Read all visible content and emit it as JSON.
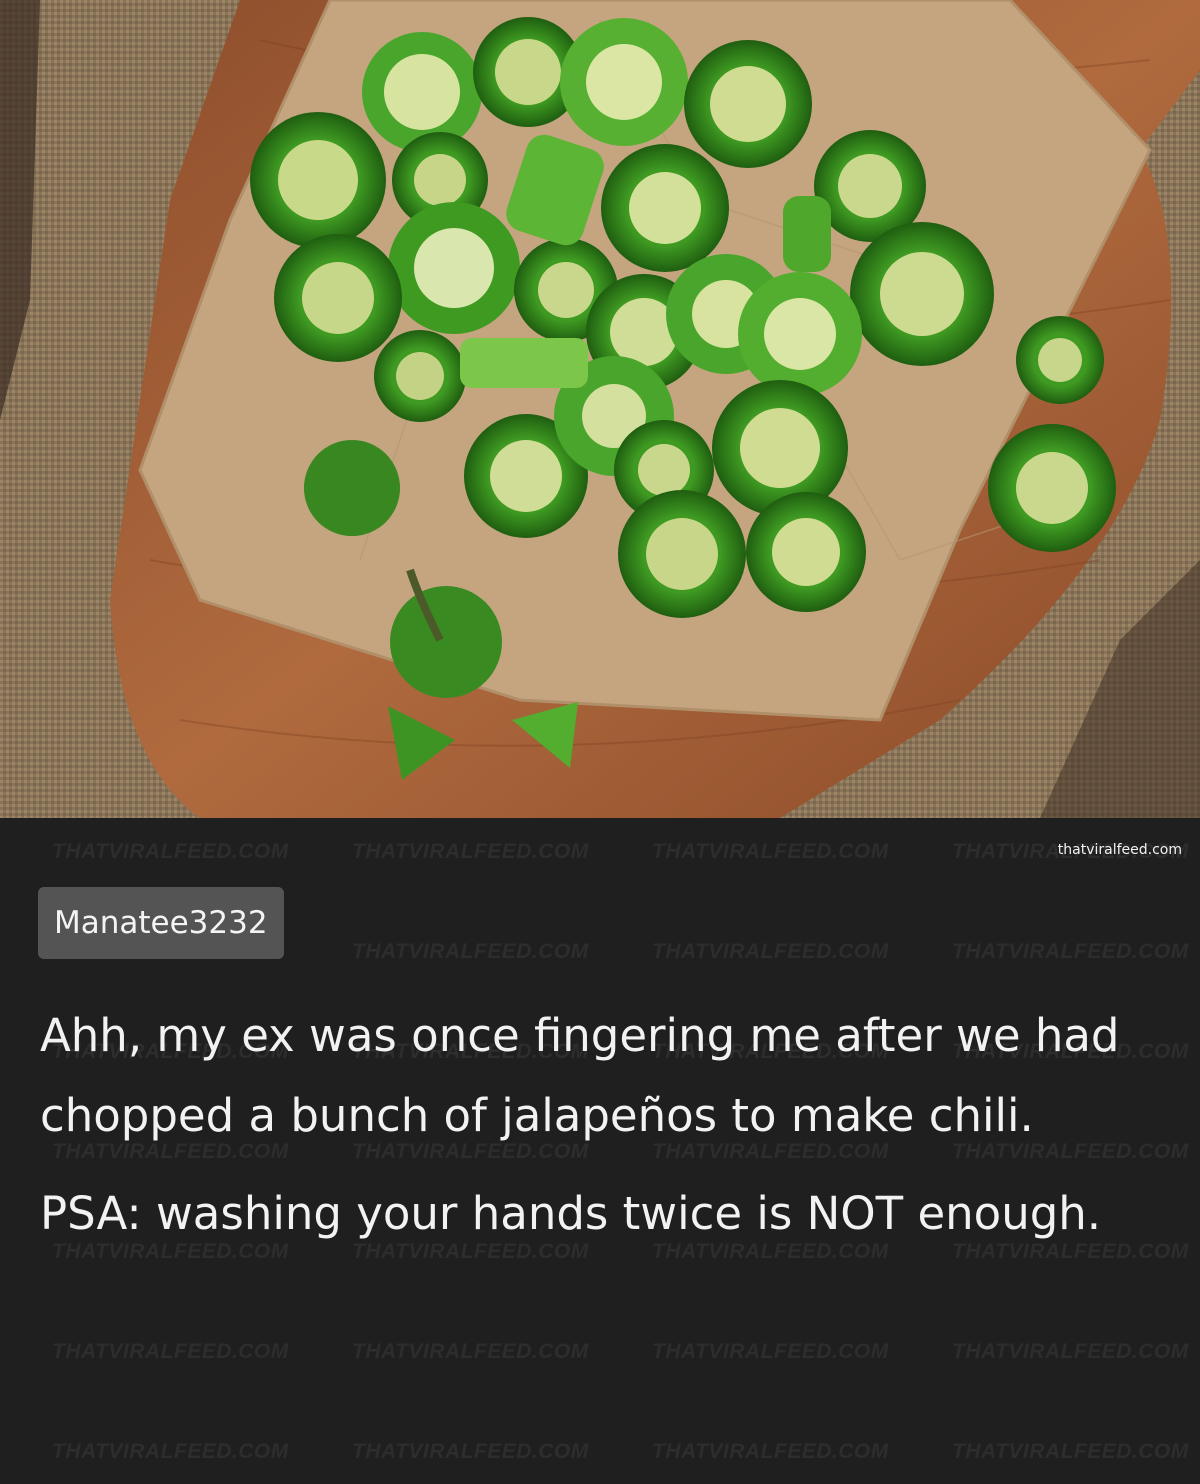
{
  "post": {
    "username": "Manatee3232",
    "paragraphs": [
      "Ahh, my ex was once fingering me after we had chopped a bunch of jalapeños to make chili.",
      "PSA: washing your hands twice is NOT enough."
    ]
  },
  "branding": {
    "site": "thatviralfeed.com",
    "watermark": "THATVIRALFEED.COM"
  },
  "photo": {
    "subject": "sliced green jalapeño peppers on parchment paper over a wooden board and burlap"
  },
  "colors": {
    "caption_bg": "#1f1f1f",
    "username_badge": "#545454",
    "text": "#f2f2f2"
  }
}
